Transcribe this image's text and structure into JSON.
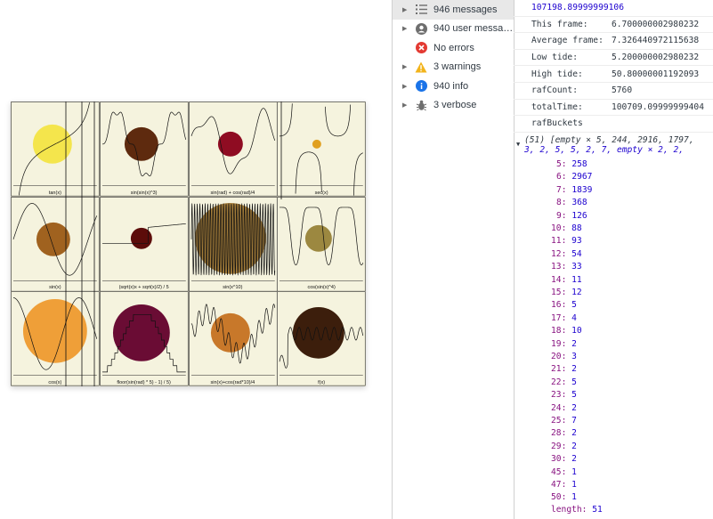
{
  "plots": [
    {
      "label": "tan(x)",
      "color": "#f4e54c",
      "kind": "tan"
    },
    {
      "label": "sin(sin(x)^3)",
      "color": "#5e2a0e",
      "kind": "sinsin"
    },
    {
      "label": "sin(rad) + cos(rad)/4",
      "color": "#8f0c22",
      "kind": "sincos"
    },
    {
      "label": "sec(x)",
      "color": "#e0a020",
      "kind": "sec"
    },
    {
      "label": "sin(x)",
      "color": "#a0621f",
      "kind": "sin"
    },
    {
      "label": "(sqrt(x)x + sqrt(x)/2) / 5",
      "color": "#5c0c0a",
      "kind": "sqrt"
    },
    {
      "label": "sin(x^10)",
      "color": "#a47d3a",
      "kind": "sinx10"
    },
    {
      "label": "cos(sin(x)^4)",
      "color": "#9c8840",
      "kind": "cossin"
    },
    {
      "label": "cos(x)",
      "color": "#ef9f38",
      "kind": "cos"
    },
    {
      "label": "floor(sin(rad) * 5) - 1) / 5)",
      "color": "#6a0c34",
      "kind": "floor"
    },
    {
      "label": "sin(x)+cos(rad*10)/4",
      "color": "#c8782a",
      "kind": "sinrad10"
    },
    {
      "label": "f(x)",
      "color": "#3c1e0c",
      "kind": "fx"
    }
  ],
  "sidebar": [
    {
      "label": "946 messages",
      "icon": "list-icon",
      "selected": true,
      "arrow": true
    },
    {
      "label": "940 user messa…",
      "icon": "user-icon",
      "selected": false,
      "arrow": true
    },
    {
      "label": "No errors",
      "icon": "error-icon",
      "selected": false,
      "arrow": false
    },
    {
      "label": "3 warnings",
      "icon": "warning-icon",
      "selected": false,
      "arrow": true
    },
    {
      "label": "940 info",
      "icon": "info-icon",
      "selected": false,
      "arrow": true
    },
    {
      "label": "3 verbose",
      "icon": "bug-icon",
      "selected": false,
      "arrow": true
    }
  ],
  "console": {
    "top_value": "107198.89999999106",
    "stats": [
      {
        "key": "This frame:",
        "value": "6.700000002980232"
      },
      {
        "key": "Average frame:",
        "value": "7.326440972115638"
      },
      {
        "key": "Low tide:",
        "value": "5.200000002980232"
      },
      {
        "key": "High tide:",
        "value": "50.80000001192093"
      },
      {
        "key": "rafCount:",
        "value": "5760"
      },
      {
        "key": "totalTime:",
        "value": "100709.09999999404"
      },
      {
        "key": "rafBuckets",
        "value": ""
      }
    ],
    "array_head_line1": "(51) [empty × 5, 244, 2916, 1797,",
    "array_head_line2": "3, 2, 5, 5, 2, 7, empty × 2, 2,",
    "entries": [
      {
        "k": "5",
        "v": "258"
      },
      {
        "k": "6",
        "v": "2967"
      },
      {
        "k": "7",
        "v": "1839"
      },
      {
        "k": "8",
        "v": "368"
      },
      {
        "k": "9",
        "v": "126"
      },
      {
        "k": "10",
        "v": "88"
      },
      {
        "k": "11",
        "v": "93"
      },
      {
        "k": "12",
        "v": "54"
      },
      {
        "k": "13",
        "v": "33"
      },
      {
        "k": "14",
        "v": "11"
      },
      {
        "k": "15",
        "v": "12"
      },
      {
        "k": "16",
        "v": "5"
      },
      {
        "k": "17",
        "v": "4"
      },
      {
        "k": "18",
        "v": "10"
      },
      {
        "k": "19",
        "v": "2"
      },
      {
        "k": "20",
        "v": "3"
      },
      {
        "k": "21",
        "v": "2"
      },
      {
        "k": "22",
        "v": "5"
      },
      {
        "k": "23",
        "v": "5"
      },
      {
        "k": "24",
        "v": "2"
      },
      {
        "k": "25",
        "v": "7"
      },
      {
        "k": "28",
        "v": "2"
      },
      {
        "k": "29",
        "v": "2"
      },
      {
        "k": "30",
        "v": "2"
      },
      {
        "k": "45",
        "v": "1"
      },
      {
        "k": "47",
        "v": "1"
      },
      {
        "k": "50",
        "v": "1"
      }
    ],
    "length_key": "length",
    "length_value": "51"
  }
}
